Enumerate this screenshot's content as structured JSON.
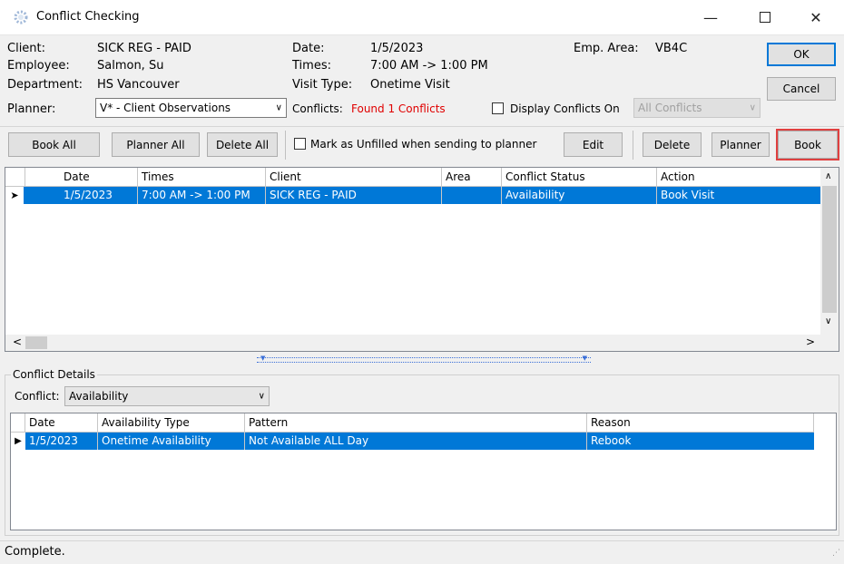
{
  "window": {
    "title": "Conflict Checking"
  },
  "info": {
    "client_label": "Client:",
    "client_value": "SICK REG - PAID",
    "employee_label": "Employee:",
    "employee_value": "Salmon, Su",
    "department_label": "Department:",
    "department_value": "HS Vancouver",
    "date_label": "Date:",
    "date_value": "1/5/2023",
    "times_label": "Times:",
    "times_value": "7:00 AM -> 1:00 PM",
    "visit_type_label": "Visit Type:",
    "visit_type_value": "Onetime Visit",
    "emp_area_label": "Emp. Area:",
    "emp_area_value": "VB4C",
    "planner_label": "Planner:",
    "planner_value": "V* - Client Observations",
    "conflicts_label": "Conflicts:",
    "conflicts_value": "Found 1 Conflicts",
    "display_conflicts_label": "Display Conflicts On",
    "display_conflicts_value": "All Conflicts"
  },
  "buttons": {
    "ok": "OK",
    "cancel": "Cancel",
    "book_all": "Book All",
    "planner_all": "Planner All",
    "delete_all": "Delete All",
    "mark_unfilled": "Mark as Unfilled when sending to planner",
    "edit": "Edit",
    "delete": "Delete",
    "planner": "Planner",
    "book": "Book"
  },
  "main_grid": {
    "columns": [
      "Date",
      "Times",
      "Client",
      "Area",
      "Conflict Status",
      "Action"
    ],
    "rows": [
      [
        "1/5/2023",
        "7:00 AM -> 1:00 PM",
        "SICK REG - PAID",
        "",
        "Availability",
        "Book Visit"
      ]
    ]
  },
  "details": {
    "group_title": "Conflict Details",
    "conflict_label": "Conflict:",
    "conflict_value": "Availability",
    "columns": [
      "Date",
      "Availability Type",
      "Pattern",
      "Reason"
    ],
    "rows": [
      [
        "1/5/2023",
        "Onetime Availability",
        "Not Available ALL Day",
        "Rebook"
      ]
    ]
  },
  "status": {
    "text": "Complete."
  },
  "colors": {
    "selection": "#0078d7",
    "conflicts_text": "#e00000",
    "highlight": "#e04040"
  }
}
